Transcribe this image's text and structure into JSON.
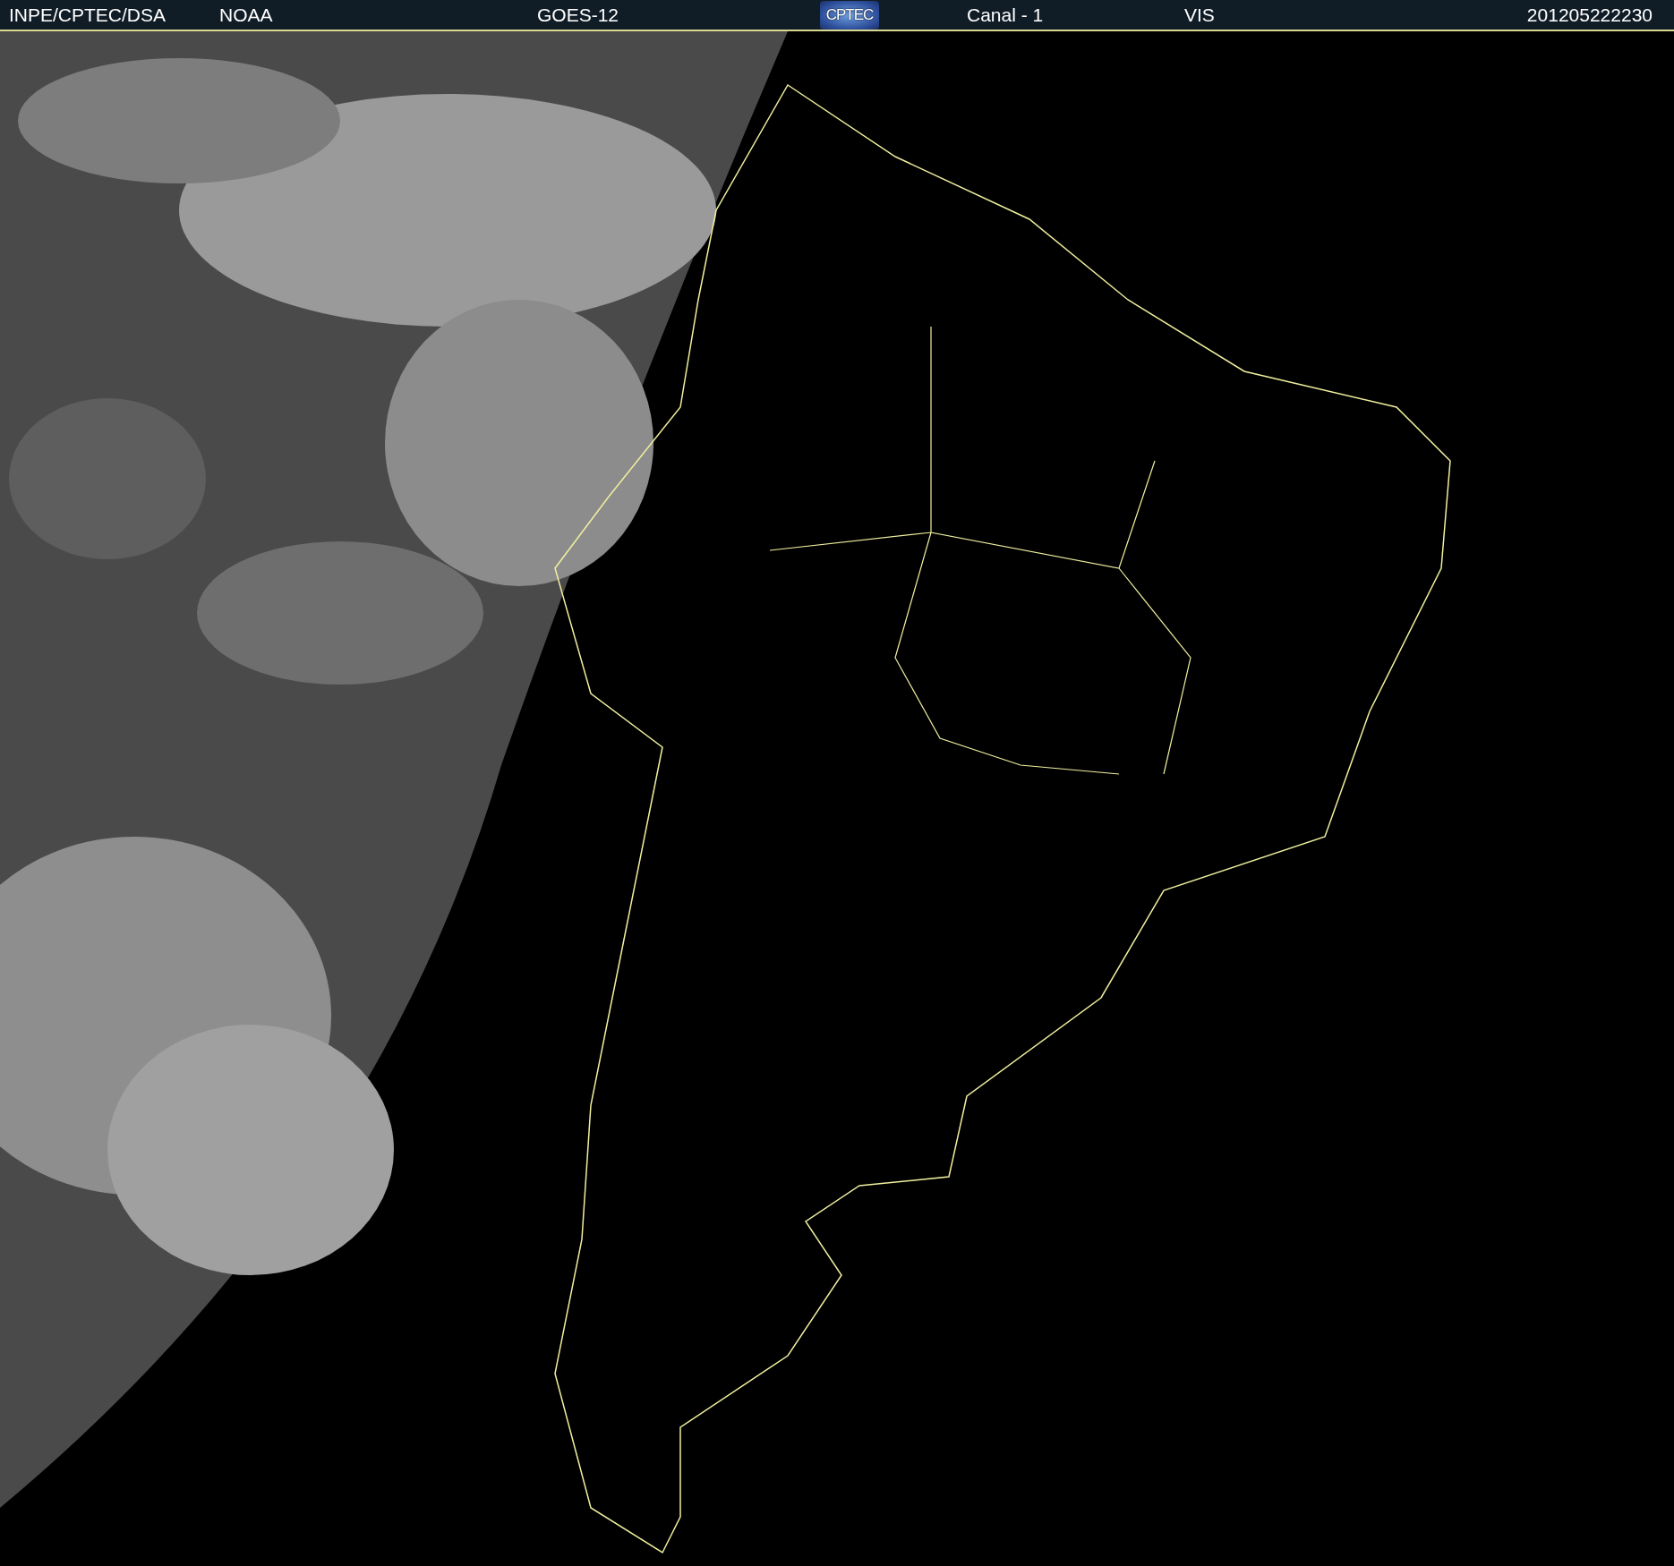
{
  "header": {
    "source": "INPE/CPTEC/DSA",
    "agency": "NOAA",
    "satellite": "GOES-12",
    "logo": "CPTEC",
    "channel": "Canal - 1",
    "band": "VIS",
    "timestamp": "201205222230"
  }
}
